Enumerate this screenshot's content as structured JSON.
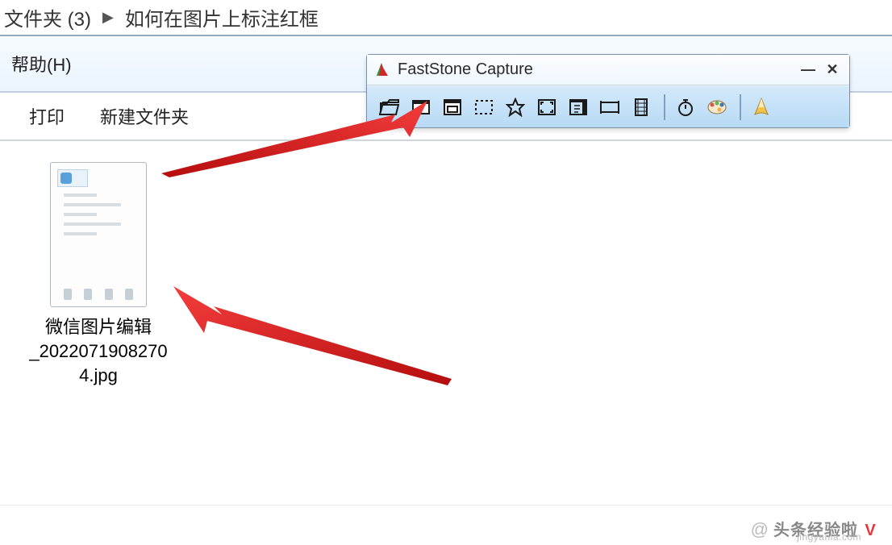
{
  "breadcrumb": {
    "segment1": "文件夹 (3)",
    "chevron": "▶",
    "segment2": "如何在图片上标注红框"
  },
  "menubar": {
    "help": "帮助(H)"
  },
  "toolbar": {
    "print": "打印",
    "new_folder": "新建文件夹"
  },
  "file": {
    "name_line1": "微信图片编辑",
    "name_line2": "_2022071908270",
    "name_line3": "4.jpg"
  },
  "faststone": {
    "title": "FastStone Capture",
    "icons": {
      "open": "open-folder-icon",
      "window": "capture-active-window-icon",
      "object": "capture-window-object-icon",
      "rect": "capture-rectangle-icon",
      "freehand": "capture-freehand-icon",
      "fullscreen": "capture-fullscreen-icon",
      "scroll": "capture-scrolling-icon",
      "fixed": "capture-fixed-region-icon",
      "video": "screen-recorder-icon",
      "delay": "delay-timer-icon",
      "settings": "settings-icon",
      "output": "output-destination-icon"
    },
    "controls": {
      "minimize": "—",
      "close": "✕"
    }
  },
  "watermark": {
    "at": "@",
    "main": "头条经验啦",
    "badge": "V",
    "sub": "jingyanla.com"
  }
}
